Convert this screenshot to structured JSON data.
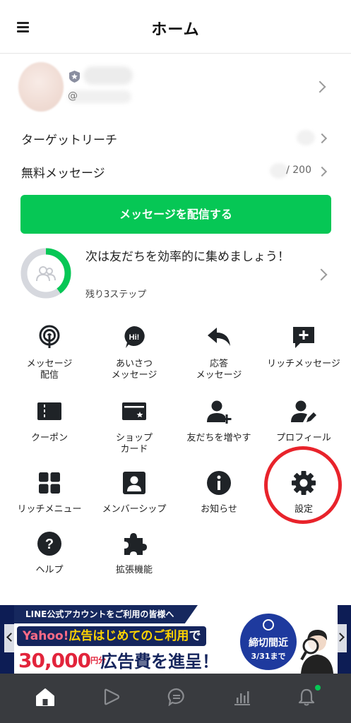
{
  "header": {
    "title": "ホーム"
  },
  "account": {
    "id_prefix": "@"
  },
  "rows": {
    "target_reach": "ターゲットリーチ",
    "free_messages": "無料メッセージ",
    "free_messages_count": "/ 200"
  },
  "broadcast_button": "メッセージを配信する",
  "progress": {
    "text": "次は友だちを効率的に集めましょう！",
    "sub": "残り3ステップ",
    "fraction": 0.4
  },
  "grid": [
    {
      "label": "メッセージ\n配信",
      "icon": "broadcast-icon"
    },
    {
      "label": "あいさつ\nメッセージ",
      "icon": "greeting-icon"
    },
    {
      "label": "応答\nメッセージ",
      "icon": "reply-icon"
    },
    {
      "label": "リッチメッセージ",
      "icon": "rich-message-icon"
    },
    {
      "label": "クーポン",
      "icon": "coupon-icon"
    },
    {
      "label": "ショップ\nカード",
      "icon": "shop-card-icon"
    },
    {
      "label": "友だちを増やす",
      "icon": "add-friend-icon"
    },
    {
      "label": "プロフィール",
      "icon": "profile-icon"
    },
    {
      "label": "リッチメニュー",
      "icon": "rich-menu-icon"
    },
    {
      "label": "メンバーシップ",
      "icon": "membership-icon"
    },
    {
      "label": "お知らせ",
      "icon": "info-icon"
    },
    {
      "label": "設定",
      "icon": "gear-icon"
    },
    {
      "label": "ヘルプ",
      "icon": "help-icon"
    },
    {
      "label": "拡張機能",
      "icon": "extension-icon"
    }
  ],
  "banner": {
    "top": "LINE公式アカウントをご利用の皆様へ",
    "yahoo": "Yahoo!",
    "hl": "広告はじめてのご利用",
    "tail": "で",
    "amount": "30,000",
    "yen": "円分",
    "rest": "広告費を進呈！",
    "deadline": "締切間近",
    "deadline_date": "3/31まで"
  },
  "colors": {
    "accent_green": "#06c755",
    "highlight_red": "#e8232b",
    "nav_bg": "#393b3f"
  },
  "nav": [
    "home-icon",
    "voom-icon",
    "chat-icon",
    "analytics-icon",
    "bell-icon"
  ]
}
